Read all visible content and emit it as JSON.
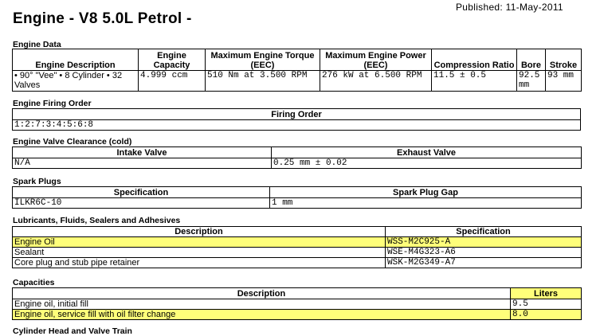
{
  "published": "Published: 11-May-2011",
  "title": "Engine - V8 5.0L Petrol -",
  "engine_data": {
    "heading": "Engine Data",
    "columns": [
      "Engine Description",
      "Engine Capacity",
      "Maximum Engine Torque (EEC)",
      "Maximum Engine Power (EEC)",
      "Compression Ratio",
      "Bore",
      "Stroke"
    ],
    "row": [
      "• 90° \"Vee\" • 8 Cylinder • 32 Valves",
      "4.999 ccm",
      "510 Nm at 3.500 RPM",
      "276 kW at 6.500 RPM",
      "11.5 ± 0.5",
      "92.5 mm",
      "93 mm"
    ]
  },
  "firing_order": {
    "heading": "Engine Firing Order",
    "column": "Firing Order",
    "value": "1:2:7:3:4:5:6:8"
  },
  "valve_clearance": {
    "heading": "Engine Valve Clearance (cold)",
    "columns": [
      "Intake Valve",
      "Exhaust Valve"
    ],
    "row": [
      "N/A",
      "0.25 mm ± 0.02"
    ]
  },
  "spark_plugs": {
    "heading": "Spark Plugs",
    "columns": [
      "Specification",
      "Spark Plug Gap"
    ],
    "row": [
      "ILKR6C-10",
      "1 mm"
    ]
  },
  "lubricants": {
    "heading": "Lubricants, Fluids, Sealers and Adhesives",
    "columns": [
      "Description",
      "Specification"
    ],
    "rows": [
      [
        "Engine Oil",
        "WSS-M2C925-A"
      ],
      [
        "Sealant",
        "WSE-M4G323-A6"
      ],
      [
        "Core plug and stub pipe retainer",
        "WSK-M2G349-A7"
      ]
    ]
  },
  "capacities": {
    "heading": "Capacities",
    "columns": [
      "Description",
      "Liters"
    ],
    "rows": [
      [
        "Engine oil, initial fill",
        "9.5"
      ],
      [
        "Engine oil, service fill with oil filter change",
        "8.0"
      ]
    ]
  },
  "next_heading": "Cylinder Head and Valve Train",
  "highlight_color": "#ffff7a"
}
